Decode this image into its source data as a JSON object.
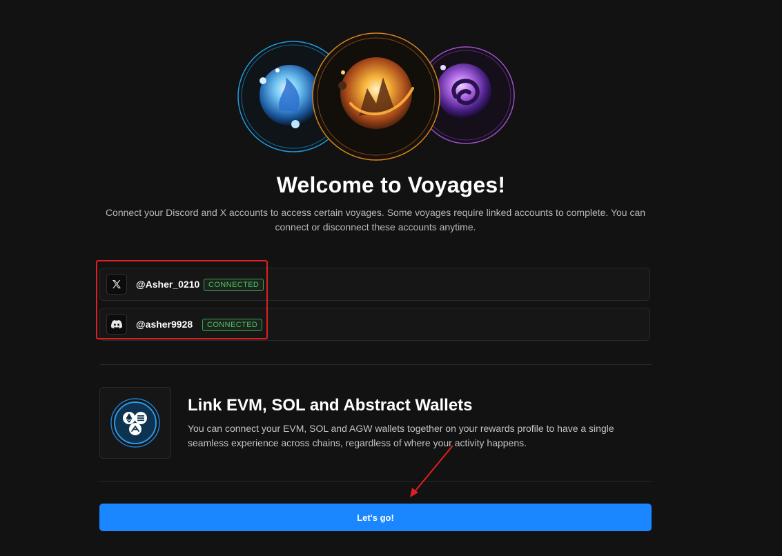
{
  "header": {
    "title": "Welcome to Voyages!",
    "subtitle": "Connect your Discord and X accounts to access certain voyages. Some voyages require linked accounts to complete. You can connect or disconnect these accounts anytime."
  },
  "hero": {
    "orbs": [
      {
        "name": "water-orb",
        "color": "#2aa3e8"
      },
      {
        "name": "fire-orb",
        "color": "#e08a1c"
      },
      {
        "name": "void-orb",
        "color": "#b25ee0"
      }
    ]
  },
  "accounts": [
    {
      "platform": "x",
      "icon": "x-logo-icon",
      "handle": "@Asher_0210",
      "status": "CONNECTED"
    },
    {
      "platform": "discord",
      "icon": "discord-logo-icon",
      "handle": "@asher9928",
      "status": "CONNECTED"
    }
  ],
  "wallets": {
    "icon": "wallets-link-icon",
    "title": "Link EVM, SOL and Abstract Wallets",
    "description": "You can connect your EVM, SOL and AGW wallets together on your rewards profile to have a single seamless experience across chains, regardless of where your activity happens."
  },
  "cta": {
    "label": "Let's go!"
  },
  "colors": {
    "background": "#121212",
    "accent": "#1a86ff",
    "connected": "#4fc45f",
    "annotation": "#e02020"
  }
}
